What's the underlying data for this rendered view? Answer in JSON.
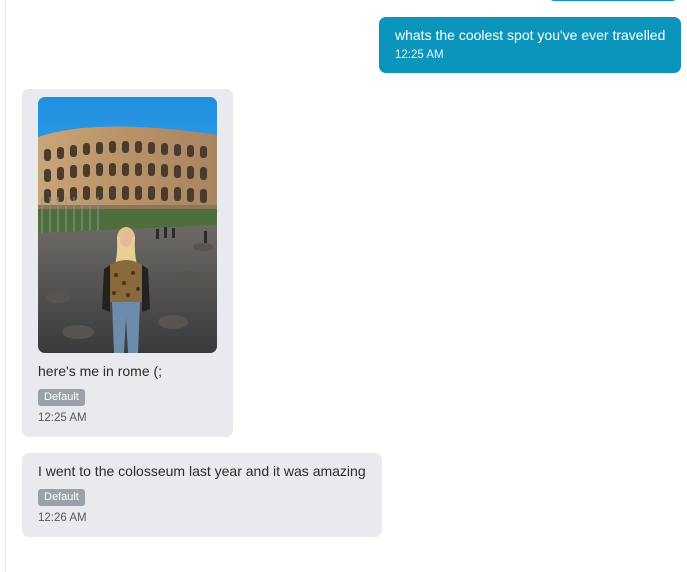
{
  "colors": {
    "outgoing_bubble": "#0b95bd",
    "incoming_bubble": "#e9eaee",
    "tag_background": "#9aa1a9"
  },
  "messages": [
    {
      "direction": "outgoing",
      "text": "whats the coolest spot you've ever travelled",
      "time": "12:25 AM"
    },
    {
      "direction": "incoming",
      "attachment": "photo-of-person-at-colosseum",
      "text": "here's me in rome (;",
      "tag": "Default",
      "time": "12:25 AM"
    },
    {
      "direction": "incoming",
      "text": "I went to the colosseum last year and it was amazing",
      "tag": "Default",
      "time": "12:26 AM"
    }
  ]
}
